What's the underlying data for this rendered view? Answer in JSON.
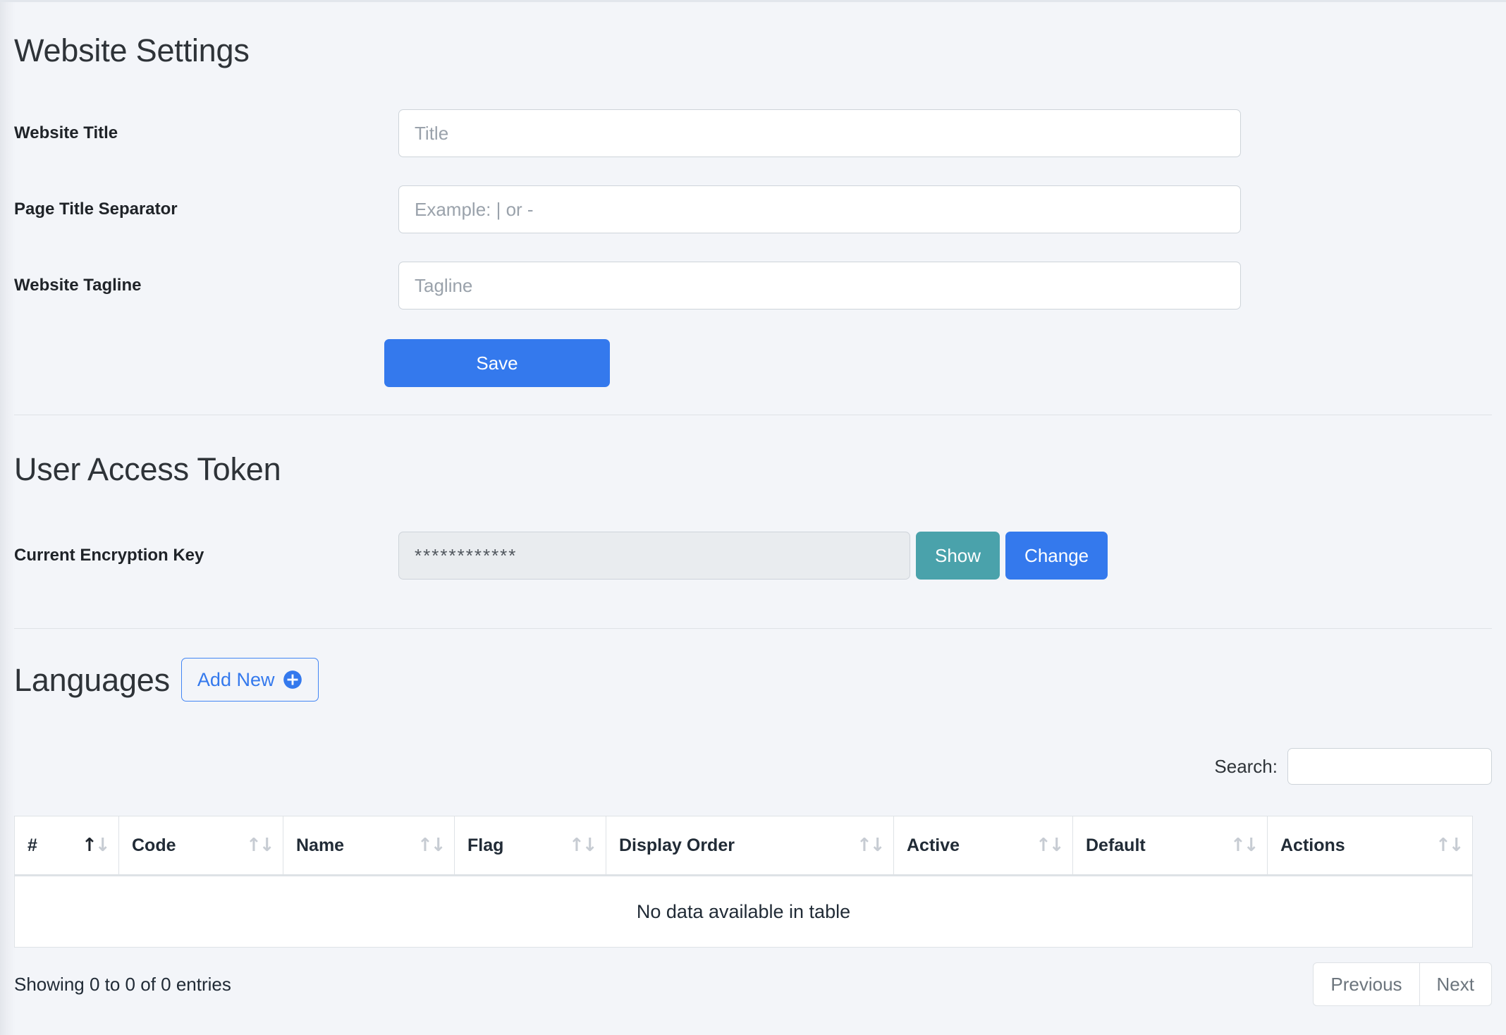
{
  "website_settings": {
    "heading": "Website Settings",
    "fields": [
      {
        "label": "Website Title",
        "placeholder": "Title",
        "value": ""
      },
      {
        "label": "Page Title Separator",
        "placeholder": "Example: | or -",
        "value": ""
      },
      {
        "label": "Website Tagline",
        "placeholder": "Tagline",
        "value": ""
      }
    ],
    "save_label": "Save"
  },
  "user_access_token": {
    "heading": "User Access Token",
    "key_label": "Current Encryption Key",
    "key_value": "************",
    "show_label": "Show",
    "change_label": "Change"
  },
  "languages": {
    "heading": "Languages",
    "add_new_label": "Add New",
    "add_new_icon": "circle-plus-icon",
    "search_label": "Search:",
    "search_value": "",
    "search_placeholder": "",
    "table": {
      "columns": [
        {
          "label": "#",
          "sort": "asc"
        },
        {
          "label": "Code",
          "sort": "none"
        },
        {
          "label": "Name",
          "sort": "none"
        },
        {
          "label": "Flag",
          "sort": "none"
        },
        {
          "label": "Display Order",
          "sort": "none"
        },
        {
          "label": "Active",
          "sort": "none"
        },
        {
          "label": "Default",
          "sort": "none"
        },
        {
          "label": "Actions",
          "sort": "none"
        }
      ],
      "rows": [],
      "empty_text": "No data available in table"
    },
    "entries_info": "Showing 0 to 0 of 0 entries",
    "previous_label": "Previous",
    "next_label": "Next"
  },
  "colors": {
    "page_background": "#f3f5f9",
    "primary_blue": "#3479ed",
    "teal": "#4aa2ab",
    "border_gray": "#ced4da",
    "text_dark": "#212b36",
    "muted": "#6c757d"
  }
}
